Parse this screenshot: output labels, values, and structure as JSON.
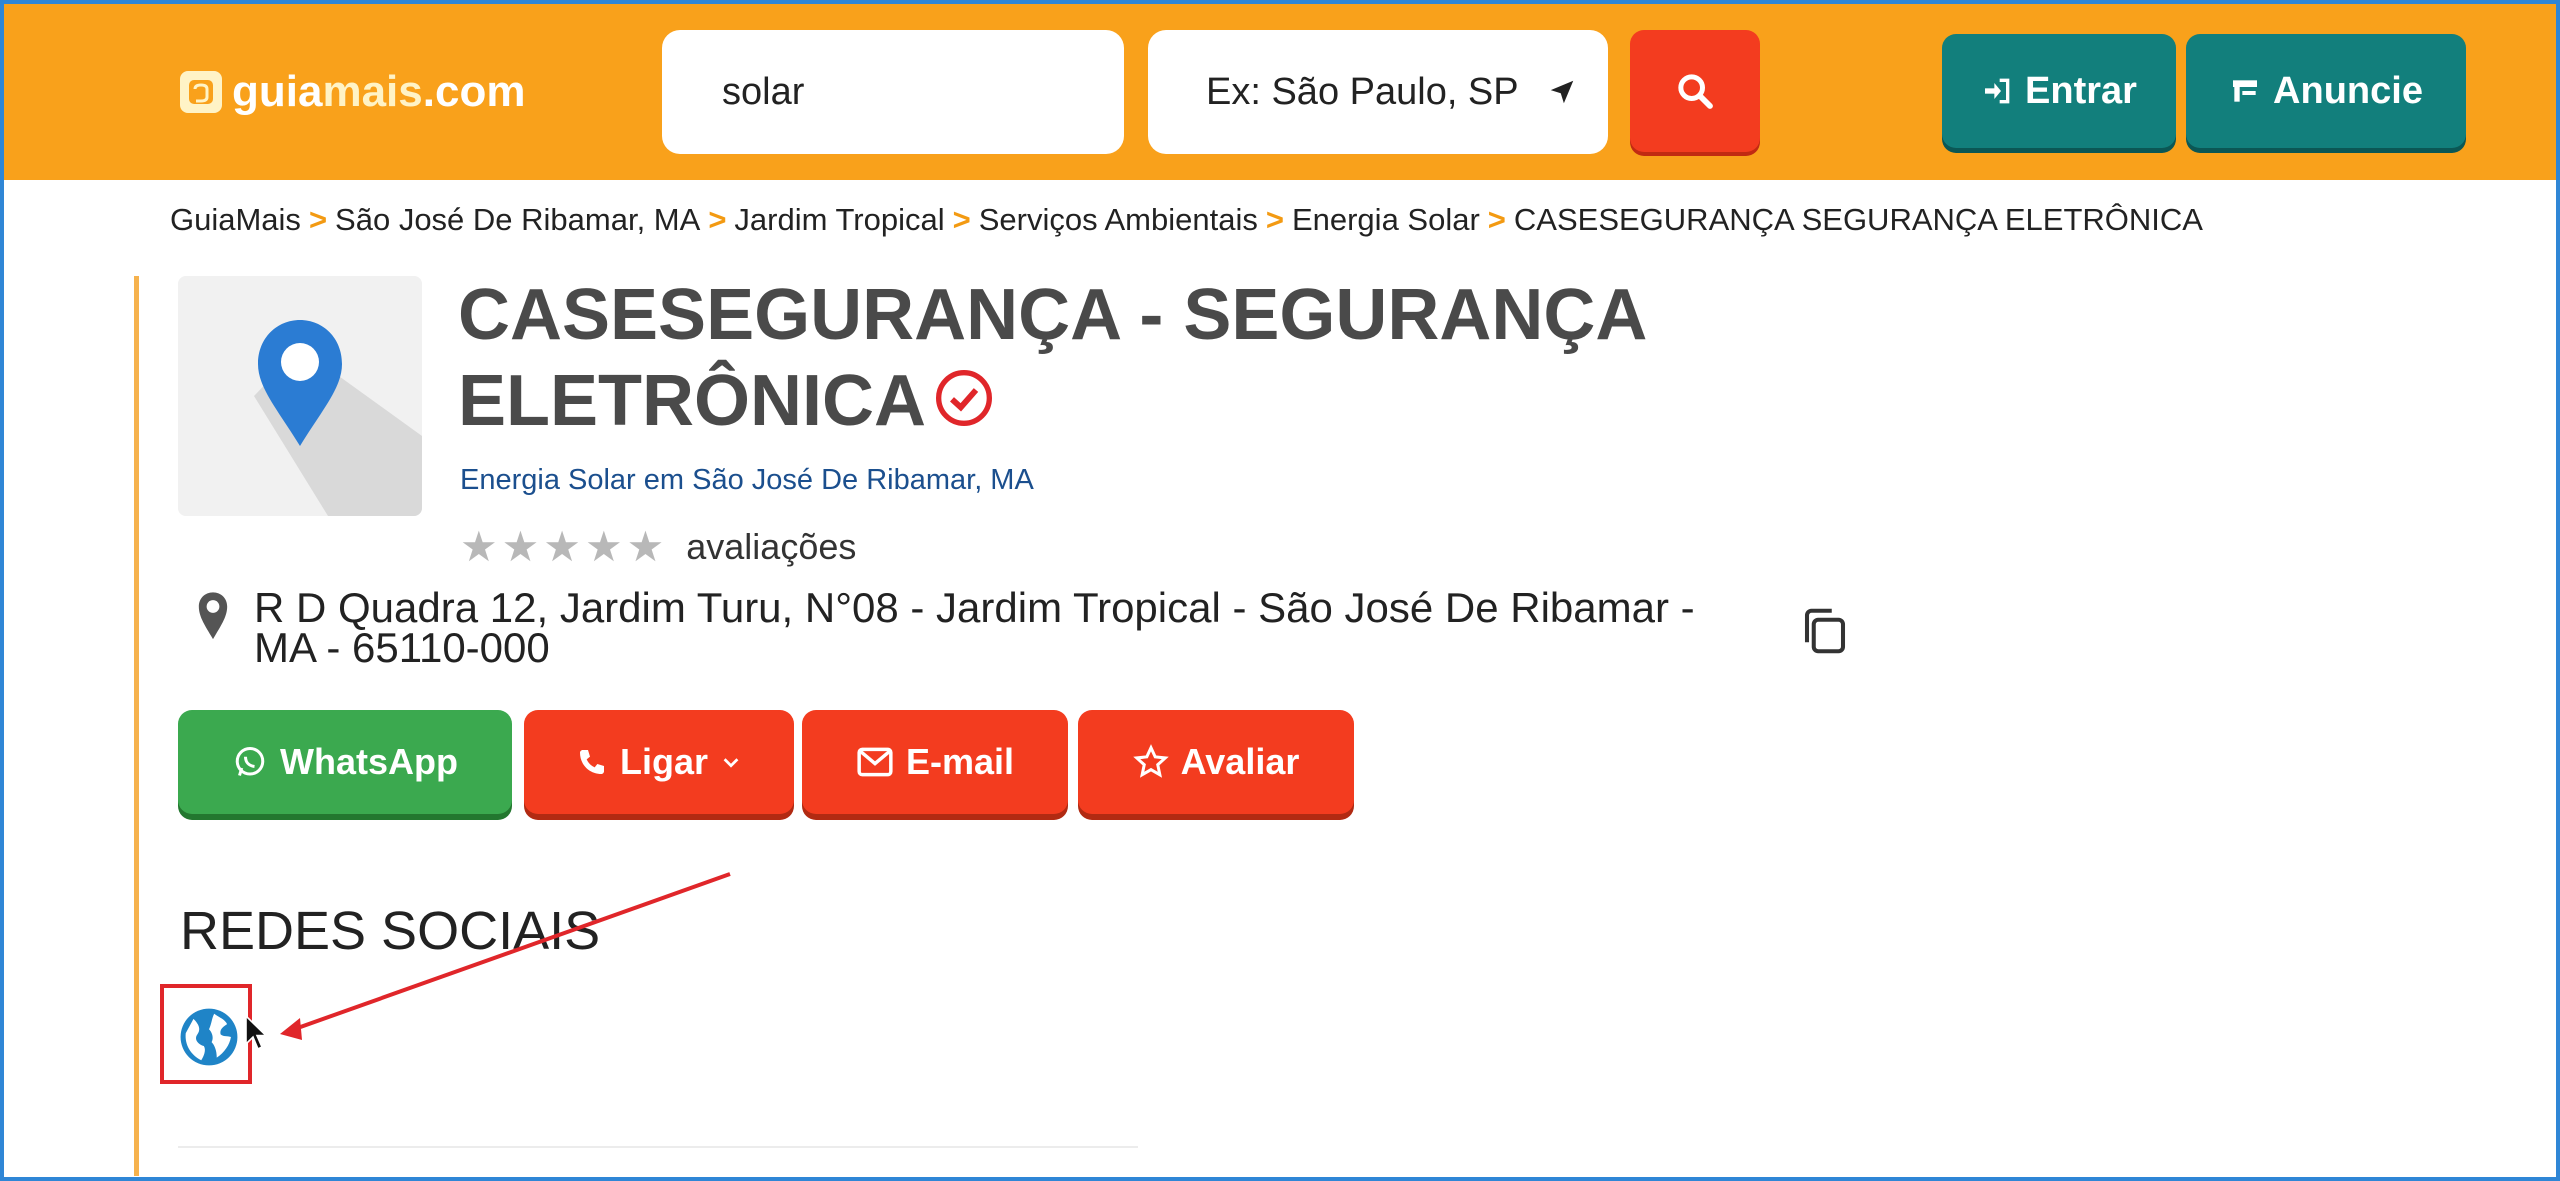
{
  "header": {
    "logo": {
      "prefix": "guia",
      "highlight": "mais",
      "suffix": ".com",
      "icon": "guiamais-logo-icon"
    },
    "search_value": "solar",
    "location_placeholder": "Ex: São Paulo, SP",
    "search_icon": "search-icon",
    "entrar_label": "Entrar",
    "anuncie_label": "Anuncie",
    "colors": {
      "bar": "#f9a11b",
      "search_button": "#f33c1f",
      "teal": "#127f7c"
    }
  },
  "breadcrumb": {
    "items": [
      "GuiaMais",
      "São José De Ribamar, MA",
      "Jardim Tropical",
      "Serviços Ambientais",
      "Energia Solar",
      "CASESEGURANÇA SEGURANÇA ELETRÔNICA"
    ],
    "separator": ">"
  },
  "business": {
    "title": "CASESEGURANÇA - SEGURANÇA ELETRÔNICA",
    "subtitle": "Energia Solar em São José De Ribamar, MA",
    "rating_stars": 0,
    "rating_label": "avaliações",
    "address": "R D Quadra 12, Jardim Turu, N°08 - Jardim Tropical - São José De Ribamar - MA - 65110-000"
  },
  "actions": {
    "whatsapp": "WhatsApp",
    "ligar": "Ligar",
    "email": "E-mail",
    "avaliar": "Avaliar"
  },
  "social": {
    "heading": "REDES SOCIAIS",
    "icon": "globe-icon"
  },
  "colors": {
    "accent_red": "#f33c1f",
    "whatsapp_green": "#3ba94f",
    "annotation_red": "#e0262a"
  }
}
